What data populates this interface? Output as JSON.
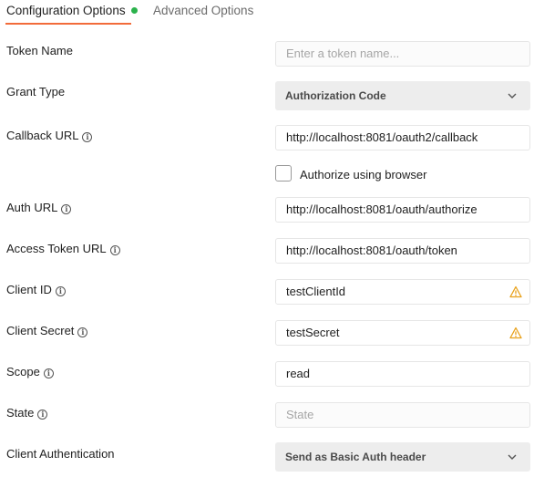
{
  "tabs": {
    "config_label": "Configuration Options",
    "advanced_label": "Advanced Options",
    "active_indicator_color": "#2bb24c",
    "underline_color": "#f26b3a"
  },
  "fields": {
    "token_name": {
      "label": "Token Name",
      "placeholder": "Enter a token name..."
    },
    "grant_type": {
      "label": "Grant Type",
      "value": "Authorization Code"
    },
    "callback_url": {
      "label": "Callback URL",
      "value": "http://localhost:8081/oauth2/callback"
    },
    "authorize_browser": {
      "label": "Authorize using browser",
      "checked": false
    },
    "auth_url": {
      "label": "Auth URL",
      "value": "http://localhost:8081/oauth/authorize"
    },
    "access_token_url": {
      "label": "Access Token URL",
      "value": "http://localhost:8081/oauth/token"
    },
    "client_id": {
      "label": "Client ID",
      "value": "testClientId"
    },
    "client_secret": {
      "label": "Client Secret",
      "value": "testSecret"
    },
    "scope": {
      "label": "Scope",
      "value": "read"
    },
    "state": {
      "label": "State",
      "placeholder": "State"
    },
    "client_auth": {
      "label": "Client Authentication",
      "value": "Send as Basic Auth header"
    }
  },
  "icons": {
    "info": "info-icon",
    "warning": "warning-icon",
    "chevron": "chevron-down-icon"
  }
}
